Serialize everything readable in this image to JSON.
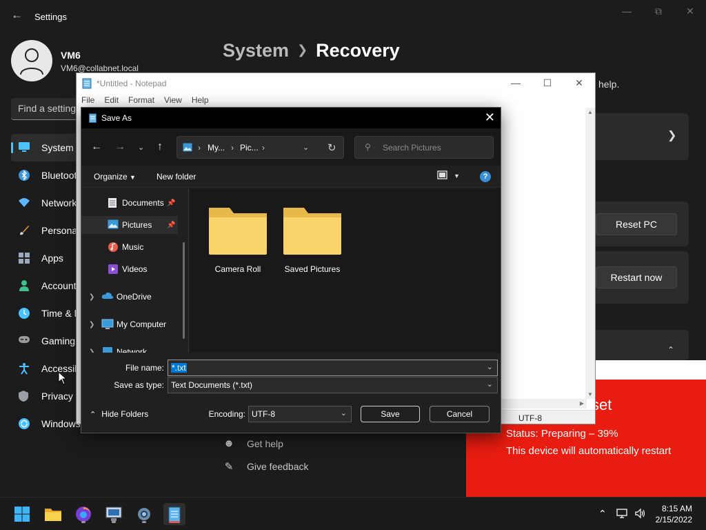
{
  "settings": {
    "title": "Settings",
    "user": {
      "name": "VM6",
      "email": "VM6@collabnet.local"
    },
    "search_placeholder": "Find a setting",
    "nav": [
      {
        "label": "System",
        "icon": "monitor-icon",
        "color": "#4cc2ff"
      },
      {
        "label": "Bluetooth & devices",
        "icon": "bluetooth-icon",
        "color": "#3a96dd"
      },
      {
        "label": "Network & internet",
        "icon": "wifi-icon",
        "color": "#5ab6ff"
      },
      {
        "label": "Personalization",
        "icon": "brush-icon",
        "color": "#e8a33c"
      },
      {
        "label": "Apps",
        "icon": "apps-icon",
        "color": "#9aa9bd"
      },
      {
        "label": "Accounts",
        "icon": "person-icon",
        "color": "#3fbf8f"
      },
      {
        "label": "Time & language",
        "icon": "clock-globe-icon",
        "color": "#4cc2ff"
      },
      {
        "label": "Gaming",
        "icon": "gamepad-icon",
        "color": "#9a9a9a"
      },
      {
        "label": "Accessibility",
        "icon": "accessibility-icon",
        "color": "#4cc2ff"
      },
      {
        "label": "Privacy & security",
        "icon": "shield-icon",
        "color": "#9aa0a6"
      },
      {
        "label": "Windows Update",
        "icon": "update-icon",
        "color": "#4cc2ff"
      }
    ],
    "breadcrumb": {
      "parent": "System",
      "current": "Recovery"
    },
    "help_tail": "help.",
    "reset_button": "Reset PC",
    "restart_button": "Restart now",
    "related": [
      {
        "label": "Get help",
        "icon": "help-icon"
      },
      {
        "label": "Give feedback",
        "icon": "feedback-icon"
      }
    ]
  },
  "reset_overlay": {
    "heading_tail": "set",
    "status": "Status: Preparing – 39%",
    "message": "This device will automatically restart"
  },
  "notepad": {
    "title": "*Untitled - Notepad",
    "menu": [
      "File",
      "Edit",
      "Format",
      "View",
      "Help"
    ],
    "status_encoding": "UTF-8"
  },
  "save_as": {
    "title": "Save As",
    "address": {
      "seg1": "My...",
      "seg2": "Pic...",
      "sep": "›"
    },
    "search_placeholder": "Search Pictures",
    "organize": "Organize",
    "new_folder": "New folder",
    "tree": [
      {
        "label": "Documents",
        "icon": "documents-icon",
        "pinned": true,
        "expandable": false,
        "indent": 2,
        "selected": false
      },
      {
        "label": "Pictures",
        "icon": "pictures-icon",
        "pinned": true,
        "expandable": false,
        "indent": 2,
        "selected": true
      },
      {
        "label": "Music",
        "icon": "music-icon",
        "pinned": false,
        "expandable": false,
        "indent": 2,
        "selected": false
      },
      {
        "label": "Videos",
        "icon": "videos-icon",
        "pinned": false,
        "expandable": false,
        "indent": 2,
        "selected": false
      },
      {
        "label": "OneDrive",
        "icon": "onedrive-icon",
        "pinned": false,
        "expandable": true,
        "indent": 1,
        "selected": false
      },
      {
        "label": "My Computer",
        "icon": "computer-icon",
        "pinned": false,
        "expandable": true,
        "indent": 1,
        "selected": false
      },
      {
        "label": "Network",
        "icon": "network-icon",
        "pinned": false,
        "expandable": true,
        "indent": 1,
        "selected": false
      }
    ],
    "folders": [
      "Camera Roll",
      "Saved Pictures"
    ],
    "file_name_label": "File name:",
    "file_name_value": "*.txt",
    "save_type_label": "Save as type:",
    "save_type_value": "Text Documents (*.txt)",
    "hide_folders": "Hide Folders",
    "encoding_label": "Encoding:",
    "encoding_value": "UTF-8",
    "save_button": "Save",
    "cancel_button": "Cancel"
  },
  "taskbar": {
    "apps": [
      "start-icon",
      "file-explorer-icon",
      "firefox-icon",
      "remote-desktop-icon",
      "settings-gear-icon",
      "notepad-icon"
    ],
    "time": "8:15 AM",
    "date": "2/15/2022"
  }
}
